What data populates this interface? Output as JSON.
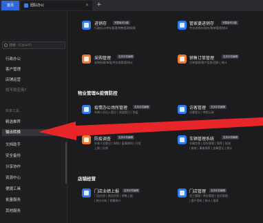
{
  "tabs": {
    "home": "首页",
    "active": "团队办公",
    "close": "×",
    "add": "+"
  },
  "sidebar": {
    "search_placeholder": "搜索（Ctrl+F）",
    "items": [
      {
        "label": "行政办公"
      },
      {
        "label": "客户管理"
      },
      {
        "label": "店铺运营"
      },
      {
        "label": "找不到应用?"
      }
    ],
    "section_title": "效率工具",
    "tools": [
      {
        "label": "精选推荐"
      },
      {
        "label": "输出转换"
      },
      {
        "label": "文档助手"
      },
      {
        "label": "安全备份"
      },
      {
        "label": "分享协作"
      },
      {
        "label": "资源中心"
      },
      {
        "label": "便捷工具"
      },
      {
        "label": "批量服务"
      },
      {
        "label": "其他服务"
      }
    ]
  },
  "main": {
    "top_cards": [
      {
        "title": "进销存",
        "badge": "完整版本功能",
        "desc": "行政办公/库存管理/销售管理/报表"
      },
      {
        "title": "管家婆进销存",
        "badge": "完整版本功能",
        "desc": "专业进销存/财务/账单管理/统计"
      },
      {
        "title": "采购管理",
        "badge": "支持手机编辑",
        "desc": "采购申请/审批/供应商管理/统计"
      },
      {
        "title": "销售订单管理",
        "badge": "支持手机编辑",
        "desc": "订单管理/客户信息/回款 | 统计"
      }
    ],
    "section1": "物业管理&疫情防控",
    "section1_cards": [
      {
        "title": "疫情办公场所管理",
        "badge": "支持手机编辑",
        "desc1": "车辆人员出入登记 | 测温登记 | 防疫",
        "desc2": ""
      },
      {
        "title": "访客管理",
        "badge": "支持手机编辑",
        "desc1": "访客登记 | 审批记录",
        "desc2": ""
      },
      {
        "title": "防疫调查",
        "badge": "支持手机编辑",
        "desc1": "外来人员登记 | 采购 | 疫情期间 | 行程",
        "desc2": "上报 | 反馈"
      },
      {
        "title": "车辆管理系统",
        "badge": "支持手机编辑",
        "desc1": "车辆信息 | 用车管理 | 保养 | 加油",
        "desc2": "| 维修 | 事故保养 | 违章登记 | 统计"
      }
    ],
    "section2": "店铺经营",
    "section2_cards": [
      {
        "title": "门店业绩上报",
        "badge": "支持手机编辑",
        "desc1": "门店信息 | 商品信息 | 销售上报",
        "desc2": "| 统计分析 | 销售统计"
      },
      {
        "title": "门店管理",
        "badge": "支持手机编辑",
        "desc1": "员工管理 | 库存管理 | 会员管理",
        "desc2": "| 客户资料 | 统计 | 报表"
      }
    ]
  },
  "colors": {
    "accent": "#2f67d8",
    "arrow": "#e8262a",
    "blue_icon": "#2f7cf0",
    "orange_icon": "#f07a2a"
  }
}
